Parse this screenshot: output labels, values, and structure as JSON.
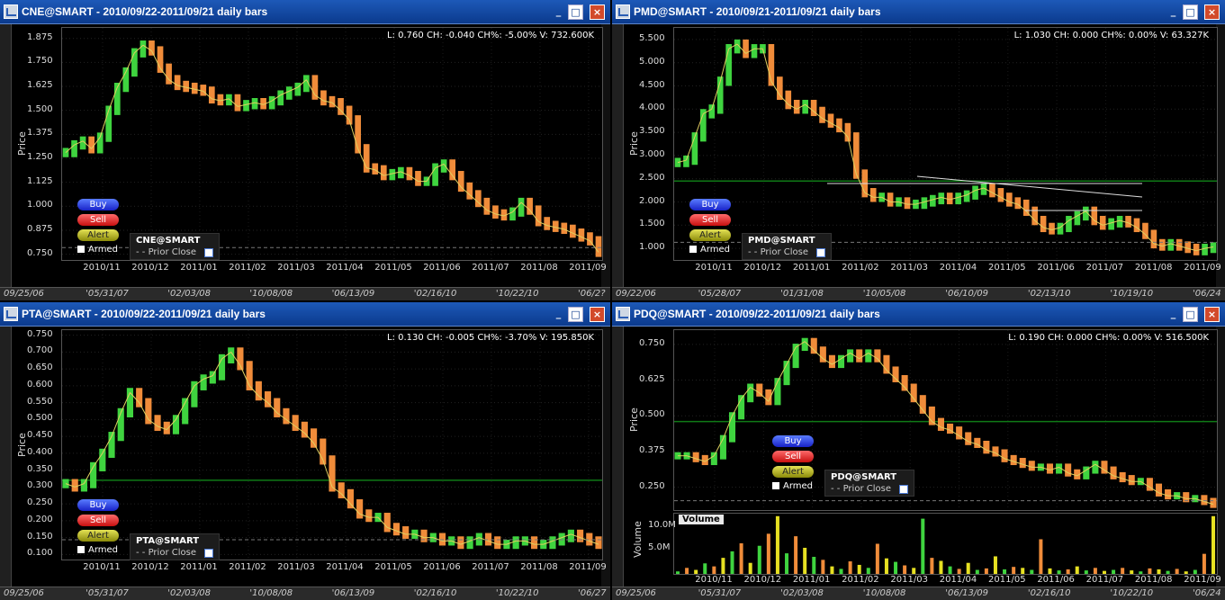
{
  "panels": [
    {
      "id": "cne",
      "title": "CNE@SMART - 2010/09/22-2011/09/21 daily bars",
      "info": "L: 0.760 CH: -0.040 CH%: -5.00% V: 732.600K",
      "ylabel": "Price",
      "yticks": [
        "1.875",
        "1.750",
        "1.625",
        "1.500",
        "1.375",
        "1.250",
        "1.125",
        "1.000",
        "0.875",
        "0.750"
      ],
      "xticks": [
        "2010/11",
        "2010/12",
        "2011/01",
        "2011/02",
        "2011/03",
        "2011/04",
        "2011/05",
        "2011/06",
        "2011/07",
        "2011/08",
        "2011/09"
      ],
      "bottom_dates": [
        "09/25/06",
        "'05/31/07",
        "'02/03/08",
        "'10/08/08",
        "'06/13/09",
        "'02/16/10",
        "'10/22/10",
        "'06/2?"
      ],
      "legend_symbol": "CNE@SMART",
      "legend_prior": "Prior Close",
      "buy": "Buy",
      "sell": "Sell",
      "alert": "Alert",
      "armed": "Armed",
      "chart_data": {
        "type": "bar",
        "ylim": [
          0.72,
          1.93
        ],
        "prior_close": null,
        "series": [
          {
            "values": [
              1.28,
              1.32,
              1.34,
              1.3,
              1.36,
              1.5,
              1.62,
              1.7,
              1.8,
              1.84,
              1.81,
              1.72,
              1.66,
              1.63,
              1.62,
              1.61,
              1.6,
              1.56,
              1.55,
              1.56,
              1.52,
              1.53,
              1.54,
              1.53,
              1.55,
              1.58,
              1.6,
              1.62,
              1.66,
              1.58,
              1.55,
              1.54,
              1.5,
              1.45,
              1.3,
              1.2,
              1.19,
              1.16,
              1.17,
              1.18,
              1.16,
              1.13,
              1.13,
              1.2,
              1.22,
              1.16,
              1.1,
              1.06,
              1.02,
              0.98,
              0.96,
              0.95,
              0.97,
              1.02,
              0.98,
              0.92,
              0.9,
              0.89,
              0.88,
              0.86,
              0.84,
              0.82,
              0.76
            ]
          }
        ]
      }
    },
    {
      "id": "pmd",
      "title": "PMD@SMART - 2010/09/21-2011/09/21 daily bars",
      "info": "L: 1.030 CH: 0.000 CH%: 0.00% V: 63.327K",
      "ylabel": "Price",
      "yticks": [
        "5.500",
        "5.000",
        "4.500",
        "4.000",
        "3.500",
        "3.000",
        "2.500",
        "2.000",
        "1.500",
        "1.000"
      ],
      "xticks": [
        "2010/11",
        "2010/12",
        "2011/01",
        "2011/02",
        "2011/03",
        "2011/04",
        "2011/05",
        "2011/06",
        "2011/07",
        "2011/08",
        "2011/09"
      ],
      "bottom_dates": [
        "09/22/06",
        "'05/28/07",
        "'01/31/08",
        "'10/05/08",
        "'06/10/09",
        "'02/13/10",
        "'10/19/10",
        "'06/24"
      ],
      "legend_symbol": "PMD@SMART",
      "legend_prior": "Prior Close",
      "buy": "Buy",
      "sell": "Sell",
      "alert": "Alert",
      "armed": "Armed",
      "chart_data": {
        "type": "bar",
        "ylim": [
          0.75,
          5.75
        ],
        "prior_close": 2.45,
        "series": [
          {
            "values": [
              2.85,
              2.9,
              3.4,
              3.9,
              4.0,
              4.6,
              5.3,
              5.4,
              5.2,
              5.3,
              5.3,
              4.6,
              4.3,
              4.1,
              4.0,
              4.1,
              3.95,
              3.8,
              3.7,
              3.6,
              3.4,
              2.6,
              2.2,
              2.1,
              2.1,
              2.0,
              2.0,
              1.95,
              1.95,
              2.0,
              2.05,
              2.1,
              2.05,
              2.1,
              2.15,
              2.25,
              2.3,
              2.2,
              2.1,
              2.0,
              1.95,
              1.8,
              1.6,
              1.45,
              1.4,
              1.45,
              1.6,
              1.7,
              1.8,
              1.6,
              1.5,
              1.55,
              1.6,
              1.55,
              1.45,
              1.3,
              1.1,
              1.05,
              1.1,
              1.05,
              1.0,
              0.95,
              1.0,
              1.03
            ]
          }
        ]
      }
    },
    {
      "id": "pta",
      "title": "PTA@SMART - 2010/09/22-2011/09/21 daily bars",
      "info": "L: 0.130 CH: -0.005 CH%: -3.70% V: 195.850K",
      "ylabel": "Price",
      "yticks": [
        "0.750",
        "0.700",
        "0.650",
        "0.600",
        "0.550",
        "0.500",
        "0.450",
        "0.400",
        "0.350",
        "0.300",
        "0.250",
        "0.200",
        "0.150",
        "0.100"
      ],
      "xticks": [
        "2010/11",
        "2010/12",
        "2011/01",
        "2011/02",
        "2011/03",
        "2011/04",
        "2011/05",
        "2011/06",
        "2011/07",
        "2011/08",
        "2011/09"
      ],
      "bottom_dates": [
        "09/25/06",
        "'05/31/07",
        "'02/03/08",
        "'10/08/08",
        "'06/13/09",
        "'02/16/10",
        "'10/22/10",
        "'06/27"
      ],
      "legend_symbol": "PTA@SMART",
      "legend_prior": "Prior Close",
      "buy": "Buy",
      "sell": "Sell",
      "alert": "Alert",
      "armed": "Armed",
      "chart_data": {
        "type": "bar",
        "ylim": [
          0.085,
          0.765
        ],
        "prior_close": 0.32,
        "series": [
          {
            "values": [
              0.31,
              0.3,
              0.31,
              0.36,
              0.4,
              0.45,
              0.52,
              0.58,
              0.55,
              0.5,
              0.48,
              0.47,
              0.5,
              0.55,
              0.6,
              0.62,
              0.63,
              0.68,
              0.7,
              0.66,
              0.6,
              0.57,
              0.55,
              0.52,
              0.5,
              0.48,
              0.46,
              0.43,
              0.38,
              0.3,
              0.28,
              0.25,
              0.22,
              0.21,
              0.21,
              0.18,
              0.17,
              0.16,
              0.16,
              0.15,
              0.15,
              0.14,
              0.14,
              0.13,
              0.14,
              0.15,
              0.14,
              0.13,
              0.13,
              0.14,
              0.14,
              0.13,
              0.13,
              0.14,
              0.15,
              0.16,
              0.15,
              0.14,
              0.13
            ]
          }
        ]
      }
    },
    {
      "id": "pdq",
      "title": "PDQ@SMART - 2010/09/22-2011/09/21 daily bars",
      "info": "L: 0.190 CH: 0.000 CH%: 0.00% V: 516.500K",
      "ylabel": "Price",
      "yticks": [
        "0.750",
        "0.625",
        "0.500",
        "0.375",
        "0.250"
      ],
      "xticks": [
        "2010/11",
        "2010/12",
        "2011/01",
        "2011/02",
        "2011/03",
        "2011/04",
        "2011/05",
        "2011/06",
        "2011/07",
        "2011/08",
        "2011/09"
      ],
      "bottom_dates": [
        "09/25/06",
        "'05/31/07",
        "'02/03/08",
        "'10/08/08",
        "'06/13/09",
        "'02/16/10",
        "'10/22/10",
        "'06/24"
      ],
      "legend_symbol": "PDQ@SMART",
      "legend_prior": "Prior Close",
      "buy": "Buy",
      "sell": "Sell",
      "alert": "Alert",
      "armed": "Armed",
      "volume_label": "Volume",
      "volume_ylabel": "Volume",
      "volume_ticks": [
        "10.0M",
        "5.0M"
      ],
      "chart_data": {
        "type": "bar",
        "ylim": [
          0.17,
          0.8
        ],
        "prior_close": 0.48,
        "series": [
          {
            "values": [
              0.36,
              0.36,
              0.35,
              0.34,
              0.36,
              0.42,
              0.5,
              0.56,
              0.6,
              0.58,
              0.55,
              0.62,
              0.68,
              0.74,
              0.76,
              0.73,
              0.7,
              0.68,
              0.7,
              0.72,
              0.7,
              0.72,
              0.7,
              0.66,
              0.63,
              0.6,
              0.56,
              0.52,
              0.48,
              0.46,
              0.45,
              0.43,
              0.41,
              0.4,
              0.38,
              0.37,
              0.35,
              0.34,
              0.33,
              0.32,
              0.32,
              0.31,
              0.32,
              0.3,
              0.29,
              0.31,
              0.33,
              0.31,
              0.29,
              0.28,
              0.27,
              0.27,
              0.25,
              0.23,
              0.22,
              0.22,
              0.21,
              0.21,
              0.2,
              0.19
            ]
          }
        ],
        "volume_ylim": [
          0,
          12
        ],
        "volume": [
          0.5,
          1.2,
          0.8,
          2.1,
          1.5,
          3.2,
          4.5,
          6.1,
          2.2,
          5.6,
          8.0,
          11.5,
          4.1,
          7.5,
          5.2,
          3.4,
          2.8,
          1.5,
          1.0,
          2.5,
          1.8,
          1.2,
          6.0,
          3.1,
          2.4,
          1.7,
          1.2,
          11.0,
          3.2,
          2.6,
          1.5,
          1.0,
          2.2,
          0.8,
          1.1,
          3.5,
          0.9,
          1.4,
          1.2,
          0.8,
          6.9,
          1.1,
          0.7,
          0.9,
          1.5,
          0.7,
          1.2,
          0.6,
          0.8,
          1.2,
          0.7,
          0.5,
          1.1,
          0.9,
          0.6,
          1.0,
          0.5,
          0.8,
          4.0,
          11.5
        ]
      }
    }
  ]
}
